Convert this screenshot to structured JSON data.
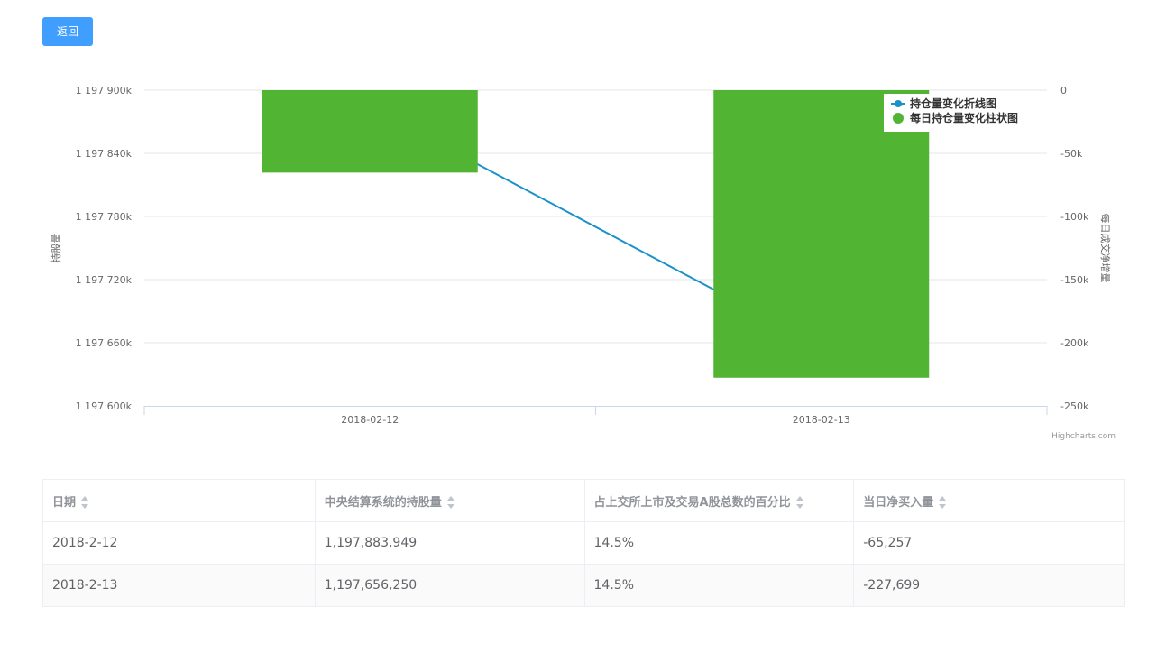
{
  "back_button": {
    "label": "返回"
  },
  "chart_data": {
    "type": "bar+line",
    "categories": [
      "2018-02-12",
      "2018-02-13"
    ],
    "series": [
      {
        "name": "持仓量变化折线图",
        "type": "line",
        "axis": "left",
        "color": "#1a91c9",
        "values": [
          1197883949,
          1197656250
        ]
      },
      {
        "name": "每日持仓量变化柱状图",
        "type": "bar",
        "axis": "right",
        "color": "#52b433",
        "values": [
          -65257,
          -227699
        ]
      }
    ],
    "y_left": {
      "label": "持股量",
      "min": 1197600000,
      "max": 1197900000,
      "ticks": [
        "1 197 900k",
        "1 197 840k",
        "1 197 780k",
        "1 197 720k",
        "1 197 660k",
        "1 197 600k"
      ]
    },
    "y_right": {
      "label": "每日成交净增量",
      "min": -250000,
      "max": 0,
      "ticks": [
        "0",
        "-50k",
        "-100k",
        "-150k",
        "-200k",
        "-250k"
      ]
    },
    "grid": true,
    "legend_position": "top-right",
    "credit": "Highcharts.com"
  },
  "table": {
    "columns": [
      "日期",
      "中央结算系统的持股量",
      "占上交所上市及交易A股总数的百分比",
      "当日净买入量"
    ],
    "rows": [
      [
        "2018-2-12",
        "1,197,883,949",
        "14.5%",
        "-65,257"
      ],
      [
        "2018-2-13",
        "1,197,656,250",
        "14.5%",
        "-227,699"
      ]
    ]
  }
}
